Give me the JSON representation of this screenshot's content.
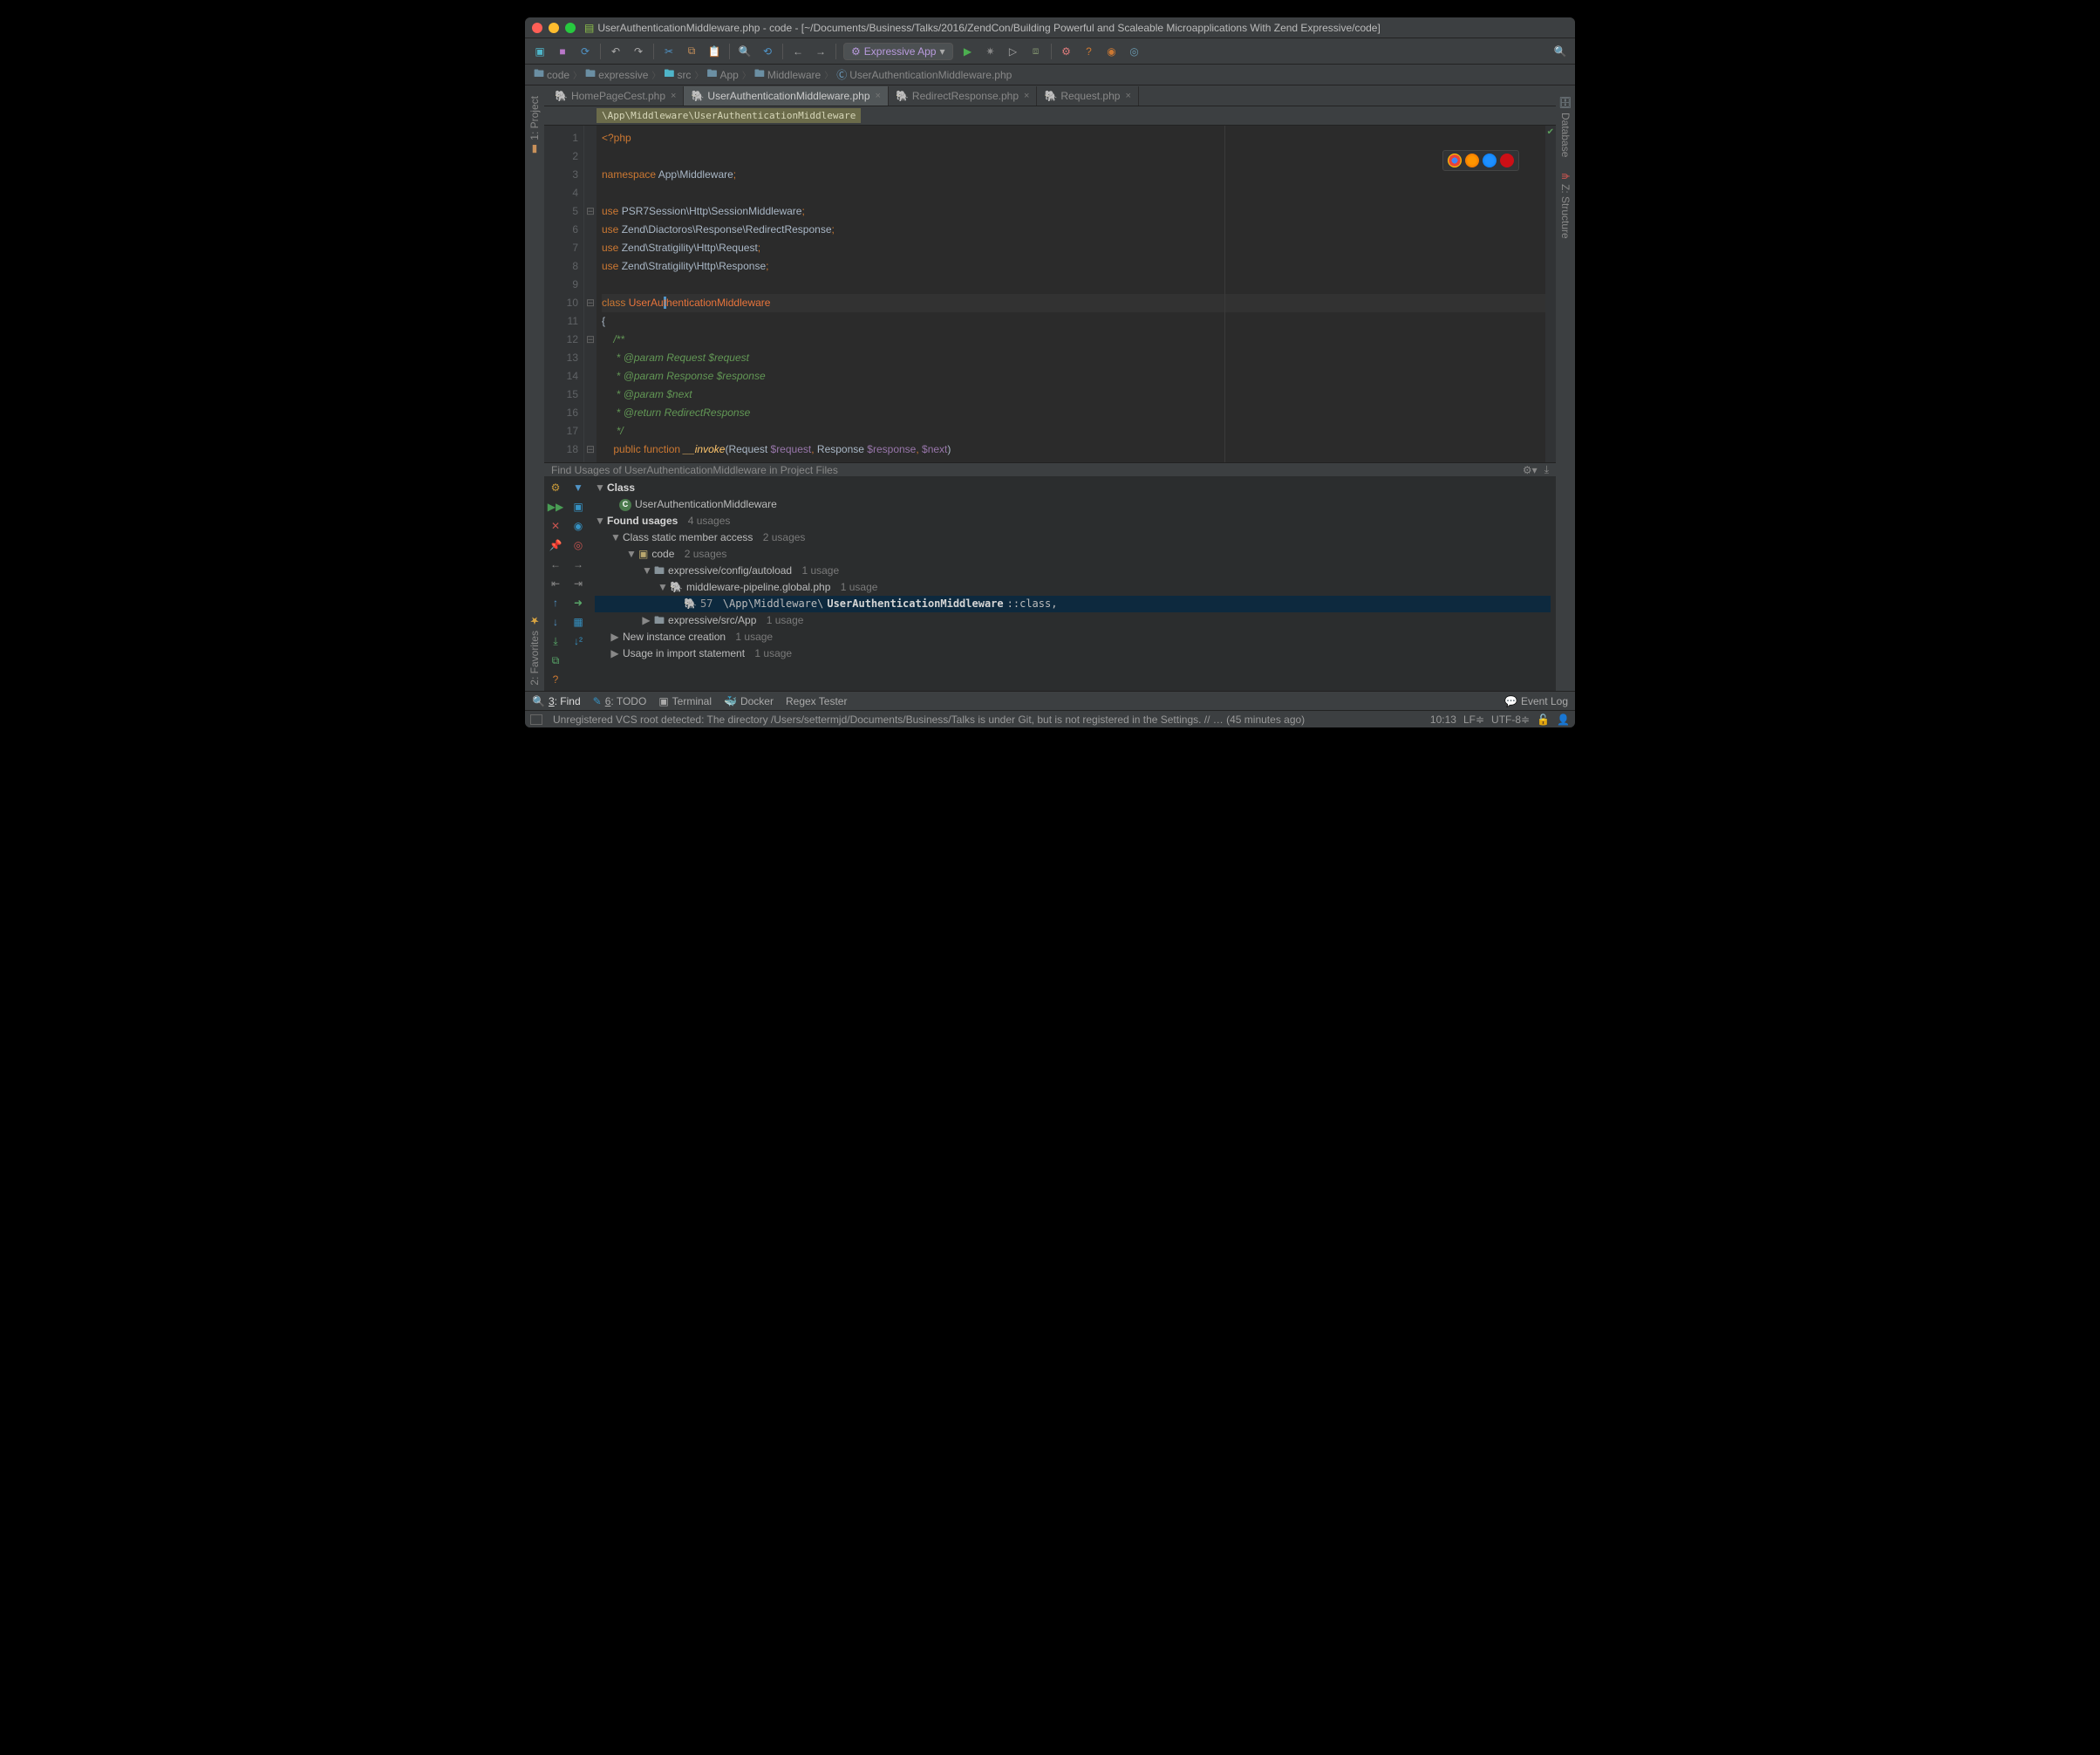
{
  "window": {
    "title": "UserAuthenticationMiddleware.php - code - [~/Documents/Business/Talks/2016/ZendCon/Building Powerful and Scaleable Microapplications With Zend Expressive/code]"
  },
  "run_config": "Expressive App",
  "breadcrumb": {
    "items": [
      "code",
      "expressive",
      "src",
      "App",
      "Middleware",
      "UserAuthenticationMiddleware.php"
    ]
  },
  "tabs": {
    "t0": "HomePageCest.php",
    "t1": "UserAuthenticationMiddleware.php",
    "t2": "RedirectResponse.php",
    "t3": "Request.php"
  },
  "namespace_bar": "\\App\\Middleware\\UserAuthenticationMiddleware",
  "code": {
    "l1": "<?php",
    "l3_kw": "namespace",
    "l3_a": "App",
    "l3_b": "Middleware",
    "l5_use": "use",
    "l5_p": "PSR7Session\\Http\\SessionMiddleware",
    "l6_p": "Zend\\Diactoros\\Response\\RedirectResponse",
    "l7_p": "Zend\\Stratigility\\Http\\Request",
    "l8_p": "Zend\\Stratigility\\Http\\Response",
    "l10_kw": "class",
    "l10_name": "UserAuthenticationMiddleware",
    "l12": "/**",
    "l13a": "@param",
    "l13b": "Request",
    "l13c": "$request",
    "l14a": "@param",
    "l14b": "Response",
    "l14c": "$response",
    "l15a": "@param",
    "l15c": "$next",
    "l16a": "@return",
    "l16b": "RedirectResponse",
    "l17": "*/",
    "l18_pub": "public",
    "l18_fn": "function",
    "l18_name": "__invoke",
    "l18_t1": "Request",
    "l18_v1": "$request",
    "l18_t2": "Response",
    "l18_v2": "$response",
    "l18_v3": "$next"
  },
  "find": {
    "title": "Find Usages of UserAuthenticationMiddleware in Project Files",
    "class_label": "Class",
    "class_name": "UserAuthenticationMiddleware",
    "found": "Found usages",
    "found_n": "4 usages",
    "static": "Class static member access",
    "static_n": "2 usages",
    "code": "code",
    "code_n": "2 usages",
    "path1": "expressive/config/autoload",
    "path1_n": "1 usage",
    "file1": "middleware-pipeline.global.php",
    "file1_n": "1 usage",
    "line1_num": "57",
    "line1_pre": "\\App\\Middleware\\",
    "line1_bold": "UserAuthenticationMiddleware",
    "line1_post": "::class,",
    "path2": "expressive/src/App",
    "path2_n": "1 usage",
    "new_inst": "New instance creation",
    "new_inst_n": "1 usage",
    "import": "Usage in import statement",
    "import_n": "1 usage"
  },
  "rails": {
    "project": "1: Project",
    "favorites": "2: Favorites",
    "database": "Database",
    "structure": "Z: Structure"
  },
  "bottom": {
    "find": "3: Find",
    "todo": "6: TODO",
    "terminal": "Terminal",
    "docker": "Docker",
    "regex": "Regex Tester",
    "eventlog": "Event Log"
  },
  "status": {
    "msg": "Unregistered VCS root detected: The directory /Users/settermjd/Documents/Business/Talks is under Git, but is not registered in the Settings. // … (45 minutes ago)",
    "pos": "10:13",
    "lf": "LF",
    "enc": "UTF-8"
  }
}
